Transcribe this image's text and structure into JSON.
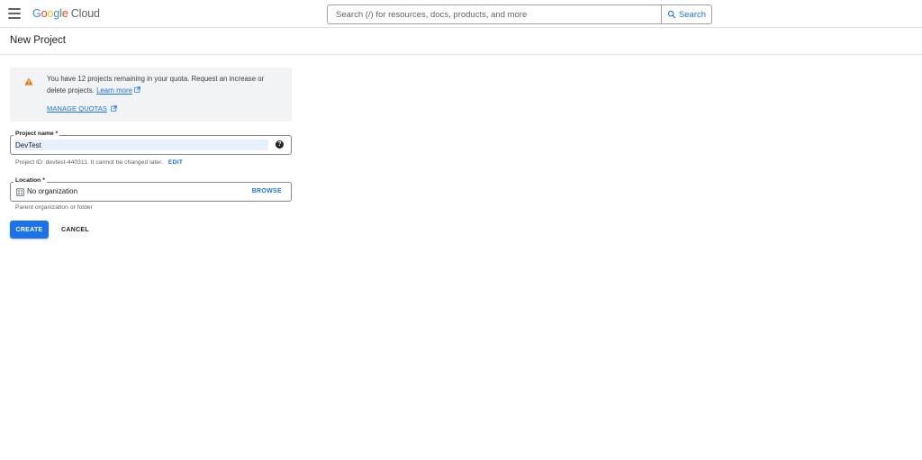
{
  "header": {
    "logo": {
      "g1": "G",
      "g2": "o",
      "g3": "o",
      "g4": "g",
      "g5": "l",
      "g6": "e",
      "product": "Cloud"
    },
    "search": {
      "placeholder": "Search (/) for resources, docs, products, and more",
      "button_label": "Search"
    },
    "icons": {
      "menu": "hamburger-menu-icon",
      "search": "search-icon"
    }
  },
  "page": {
    "title": "New Project"
  },
  "banner": {
    "text": "You have 12 projects remaining in your quota. Request an increase or delete projects.",
    "learn_more": "Learn more",
    "manage_quotas": "MANAGE QUOTAS",
    "icon": "warning-icon",
    "icon_color": "#e37400"
  },
  "project_name": {
    "label": "Project name *",
    "value": "DevTest",
    "hint": "Project ID: devtest-440311. It cannot be changed later.",
    "edit_label": "EDIT"
  },
  "location": {
    "label": "Location *",
    "value": "No organization",
    "browse_label": "BROWSE",
    "hint": "Parent organization or folder",
    "icon": "organization-icon"
  },
  "actions": {
    "create_label": "CREATE",
    "cancel_label": "CANCEL"
  },
  "colors": {
    "accent": "#1a73e8",
    "banner_bg": "#f1f3f4",
    "input_highlight": "#e8f0fe"
  }
}
